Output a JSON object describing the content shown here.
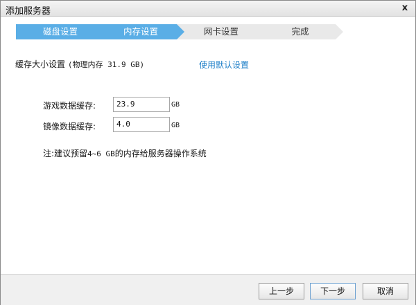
{
  "window": {
    "title": "添加服务器",
    "close_label": "x"
  },
  "steps": [
    {
      "label": "磁盘设置",
      "state": "active"
    },
    {
      "label": "内存设置",
      "state": "active"
    },
    {
      "label": "网卡设置",
      "state": "inactive"
    },
    {
      "label": "完成",
      "state": "inactive"
    }
  ],
  "cache": {
    "label": "缓存大小设置",
    "memory_info": "(物理内存 31.9 GB)",
    "default_link": "使用默认设置"
  },
  "fields": {
    "game_cache": {
      "label": "游戏数据缓存:",
      "value": "23.9",
      "unit": "GB"
    },
    "image_cache": {
      "label": "镜像数据缓存:",
      "value": "4.0",
      "unit": "GB"
    }
  },
  "note": {
    "prefix": "注:建议预留",
    "range": "4~6 GB",
    "suffix": "的内存给服务器操作系统"
  },
  "buttons": {
    "prev": "上一步",
    "next": "下一步",
    "cancel": "取消"
  },
  "colors": {
    "step_active": "#5aaee6",
    "step_inactive": "#e9e9e9",
    "link": "#1e7fc8"
  }
}
